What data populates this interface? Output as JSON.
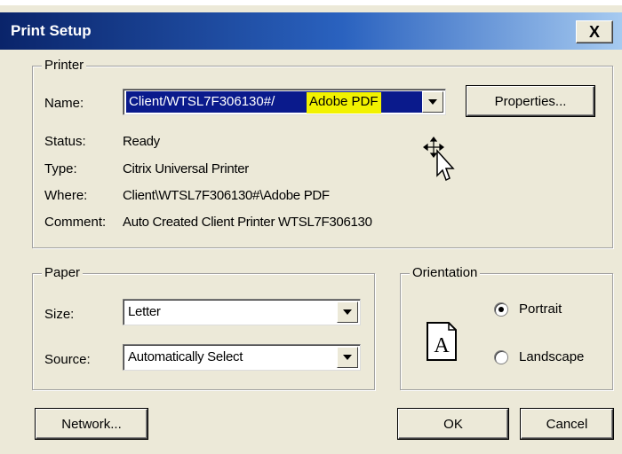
{
  "window": {
    "title": "Print Setup",
    "close_symbol": "X"
  },
  "printer": {
    "legend": "Printer",
    "name_label": "Name:",
    "name_value_part1": "Client/WTSL7F306130#/",
    "name_value_part2": "Adobe PDF",
    "properties_button": "Properties...",
    "status_label": "Status:",
    "status_value": "Ready",
    "type_label": "Type:",
    "type_value": "Citrix Universal Printer",
    "where_label": "Where:",
    "where_value": "Client\\WTSL7F306130#\\Adobe PDF",
    "comment_label": "Comment:",
    "comment_value": "Auto Created Client Printer WTSL7F306130"
  },
  "paper": {
    "legend": "Paper",
    "size_label": "Size:",
    "size_value": "Letter",
    "source_label": "Source:",
    "source_value": "Automatically Select"
  },
  "orientation": {
    "legend": "Orientation",
    "icon_letter": "A",
    "portrait_label": "Portrait",
    "landscape_label": "Landscape",
    "selected": "Portrait"
  },
  "buttons": {
    "network": "Network...",
    "ok": "OK",
    "cancel": "Cancel"
  },
  "icons": {
    "cursor": "move-cursor-icon",
    "orientation": "portrait-page-icon"
  },
  "colors": {
    "selection_bg": "#0a1a8c",
    "highlight": "#f2f200",
    "dialog_bg": "#ece9d8"
  }
}
